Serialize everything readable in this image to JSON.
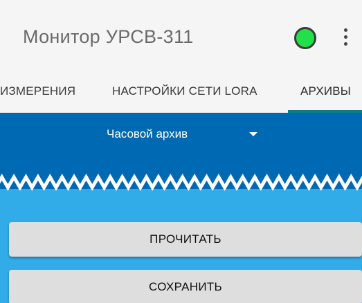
{
  "appbar": {
    "title": "Монитор УРСВ-311",
    "status_color": "#22e04a",
    "menu_icon": "more-vert-icon"
  },
  "tabs": [
    {
      "label": "ИЗМЕРЕНИЯ",
      "selected": false
    },
    {
      "label": "НАСТРОЙКИ СЕТИ LORA",
      "selected": false
    },
    {
      "label": "АРХИВЫ",
      "selected": true
    }
  ],
  "archive": {
    "selected_archive": "Часовой архив"
  },
  "actions": {
    "read_label": "ПРОЧИТАТЬ",
    "save_label": "СОХРАНИТЬ"
  },
  "colors": {
    "header_band": "#0069b4",
    "body_background": "#32ace8",
    "tab_indicator": "#0b7e82"
  }
}
